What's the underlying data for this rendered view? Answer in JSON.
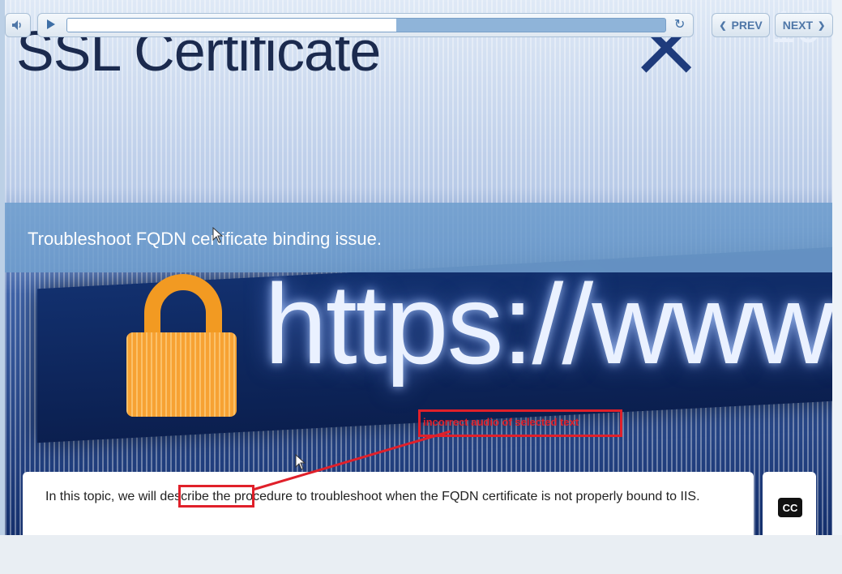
{
  "slide": {
    "title_image_text": "SSL Certificate",
    "url_image_text": "https://www.ss",
    "number_image_text": "10",
    "banner_text": "Troubleshoot FQDN certificate binding issue."
  },
  "caption": {
    "text": "In this topic, we will describe the procedure to troubleshoot when the FQDN certificate is not properly bound to IIS.",
    "cc_label": "CC"
  },
  "annotation": {
    "text": "incorrect audio of selected text",
    "highlighted_word": "describe",
    "color": "#e0202a"
  },
  "player": {
    "progress_fraction": 0.55,
    "prev_label": "PREV",
    "next_label": "NEXT",
    "icons": {
      "volume": "volume-icon",
      "play": "play-icon",
      "replay": "replay-icon",
      "prev": "chevron-left-icon",
      "next": "chevron-right-icon"
    }
  },
  "colors": {
    "banner": "#709ece",
    "controls_accent": "#4f77a8",
    "track_played": "#8fb4d9"
  }
}
